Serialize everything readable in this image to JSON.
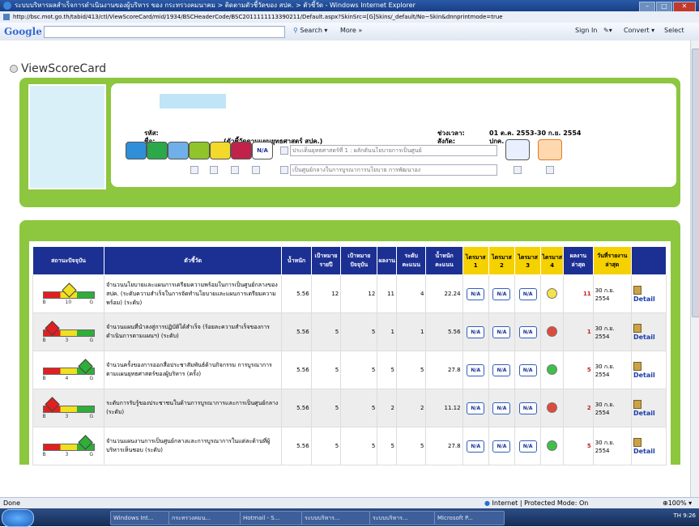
{
  "window": {
    "title": "ระบบบริหารผลสำเร็จการดำเนินงานของผู้บริหาร ของ กระทรวงคมนาคม > ติดตามตัวชี้วัดของ สปค. > ตัวชี้วัด - Windows Internet Explorer",
    "url": "http://bsc.mot.go.th/tabid/413/ctl/ViewScoreCard/mid/1934/BSCHeaderCode/BSC2011111113390211/Default.aspx?SkinSrc=[G]Skins/_default/No~Skin&dnnprintmode=true",
    "min": "–",
    "max": "□",
    "close": "✕"
  },
  "google_toolbar": {
    "logo": "Google",
    "search": "Search",
    "more": "More »",
    "signin": "Sign In",
    "convert": "Convert",
    "select": "Select"
  },
  "page": {
    "title": "ViewScoreCard"
  },
  "info": {
    "code_label": "รหัส:",
    "name_label": "ชื่อ:",
    "name_value": "(ตัวชี้วัดตามแผนยุทธศาสตร์ สปค.)",
    "period_label": "ช่วงเวลา:",
    "period_value": "01 ต.ค. 2553-30 ก.ย. 2554",
    "org_label": "สังกัด:",
    "org_value": "ปกค.",
    "na_label": "N/A",
    "dropdown1": "ประเด็นยุทธศาสตร์ที่ 1 : ผลักดันนโยบายการเป็นศูนย์",
    "dropdown2": "เป็นศูนย์กลางในการบูรณาการนโยบาย การพัฒนาอง"
  },
  "table": {
    "headers": [
      "สถานะปัจจุบัน",
      "ตัวชี้วัด",
      "น้ำหนัก",
      "เป้าหมายรายปี",
      "เป้าหมายปัจจุบัน",
      "ผลงาน",
      "ระดับคะแนน",
      "น้ำหนักคะแนน",
      "ไตรมาส 1",
      "ไตรมาส 2",
      "ไตรมาส 3",
      "ไตรมาส 4",
      "ผลงานล่าสุด",
      "วันที่รายงานล่าสุด",
      ""
    ],
    "rows": [
      {
        "gauge": {
          "b": "B",
          "v": "10",
          "g": "G",
          "color": "#f0e020",
          "pos": 0.5
        },
        "name": "จำนวนนโยบายและแผนการเตรียมความพร้อมในการเป็นศูนย์กลางของ สปค. (ระดับความสำเร็จในการจัดทำนโยบายและแผนการเตรียมความพร้อม) (ระดับ)",
        "weight": "5.56",
        "annual": "12",
        "current": "12",
        "result": "11",
        "level": "4",
        "wscore": "22.24",
        "q1": "N/A",
        "q2": "N/A",
        "q3": "N/A",
        "q4": "#f3e24a",
        "latest": "11",
        "date": "30 ก.ย. 2554",
        "detail": "Detail"
      },
      {
        "gauge": {
          "b": "B",
          "v": "3",
          "g": "G",
          "color": "#e02020",
          "pos": 0.1
        },
        "name": "จำนวนแผนที่นำลงสู่การปฏิบัติได้สำเร็จ (ร้อยละความสำเร็จของการดำเนินการตามแผนฯ) (ระดับ)",
        "weight": "5.56",
        "annual": "5",
        "current": "5",
        "result": "1",
        "level": "1",
        "wscore": "5.56",
        "q1": "N/A",
        "q2": "N/A",
        "q3": "N/A",
        "q4": "#e04a3a",
        "latest": "1",
        "date": "30 ก.ย. 2554",
        "detail": "Detail"
      },
      {
        "gauge": {
          "b": "B",
          "v": "4",
          "g": "G",
          "color": "#2fae3a",
          "pos": 0.9
        },
        "name": "จำนวนครั้งของการออกสื่อประชาสัมพันธ์ด้านกิจกรรม การบูรณาการตามแผนยุทธศาสตร์ของผู้บริหาร (ครั้ง)",
        "weight": "5.56",
        "annual": "5",
        "current": "5",
        "result": "5",
        "level": "5",
        "wscore": "27.8",
        "q1": "N/A",
        "q2": "N/A",
        "q3": "N/A",
        "q4": "#3fbf4a",
        "latest": "5",
        "date": "30 ก.ย. 2554",
        "detail": "Detail"
      },
      {
        "gauge": {
          "b": "B",
          "v": "3",
          "g": "G",
          "color": "#e02020",
          "pos": 0.1
        },
        "name": "ระดับการรับรู้ของประชาชนในด้านการบูรณาการและการเป็นศูนย์กลาง (ระดับ)",
        "weight": "5.56",
        "annual": "5",
        "current": "5",
        "result": "2",
        "level": "2",
        "wscore": "11.12",
        "q1": "N/A",
        "q2": "N/A",
        "q3": "N/A",
        "q4": "#e04a3a",
        "latest": "2",
        "date": "30 ก.ย. 2554",
        "detail": "Detail"
      },
      {
        "gauge": {
          "b": "B",
          "v": "3",
          "g": "G",
          "color": "#2fae3a",
          "pos": 0.9
        },
        "name": "จำนวนแผนงานการเป็นศูนย์กลางและการบูรณาการในแต่ละด้านที่ผู้บริหารเห็นชอบ (ระดับ)",
        "weight": "5.56",
        "annual": "5",
        "current": "5",
        "result": "5",
        "level": "5",
        "wscore": "27.8",
        "q1": "N/A",
        "q2": "N/A",
        "q3": "N/A",
        "q4": "#3fbf4a",
        "latest": "5",
        "date": "30 ก.ย. 2554",
        "detail": "Detail"
      }
    ]
  },
  "status": {
    "left": "Done",
    "protected": "Internet | Protected Mode: On",
    "zoom": "100%"
  },
  "taskbar": {
    "items": [
      "Windows Int...",
      "กระทรวงคมน...",
      "Hotmail - S...",
      "ระบบบริหาร...",
      "ระบบบริหาร...",
      "Microsoft P..."
    ],
    "tray": "TH  9:26"
  }
}
